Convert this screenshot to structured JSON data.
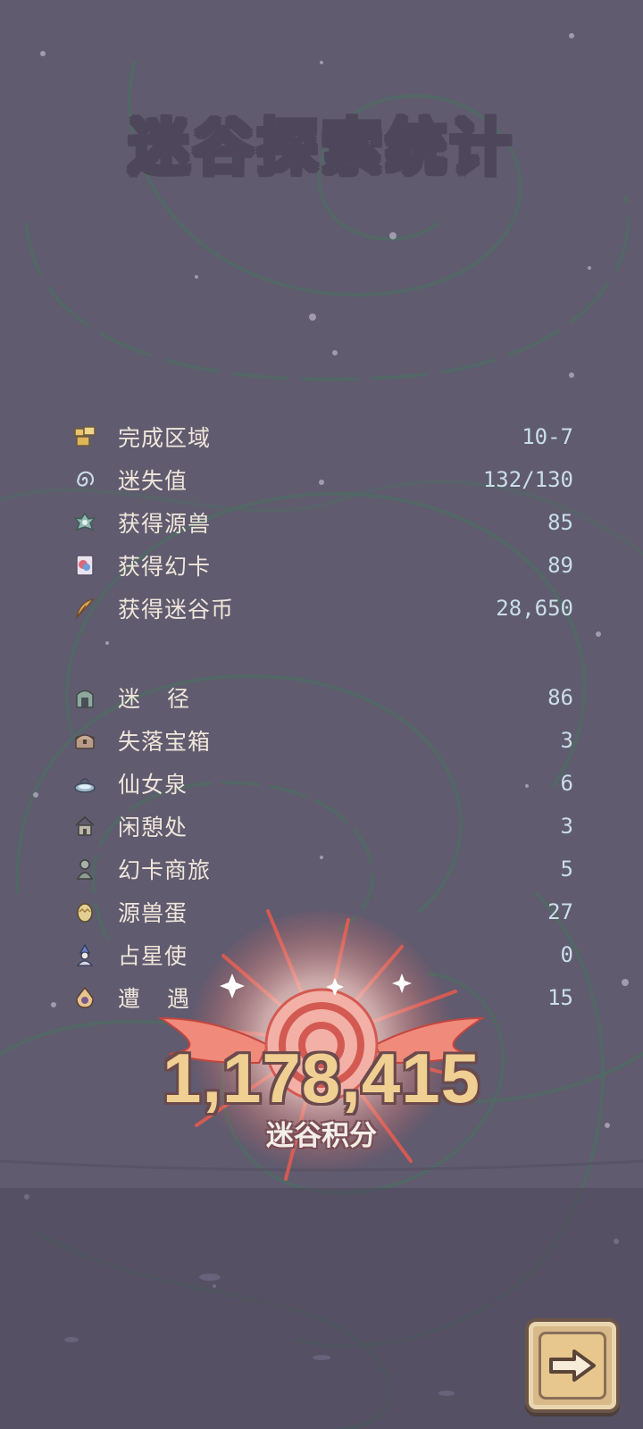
{
  "title": "迷谷探索统计",
  "summary_stats": [
    {
      "icon": "map-pieces-icon",
      "label": "完成区域",
      "value": "10-7"
    },
    {
      "icon": "swirl-icon",
      "label": "迷失值",
      "value": "132/130"
    },
    {
      "icon": "creature-icon",
      "label": "获得源兽",
      "value": "85"
    },
    {
      "icon": "card-icon",
      "label": "获得幻卡",
      "value": "89"
    },
    {
      "icon": "feather-coin-icon",
      "label": "获得迷谷币",
      "value": "28,650"
    }
  ],
  "encounter_stats": [
    {
      "icon": "path-gate-icon",
      "label": "迷径",
      "value": "86"
    },
    {
      "icon": "treasure-chest-icon",
      "label": "失落宝箱",
      "value": "3"
    },
    {
      "icon": "fairy-spring-icon",
      "label": "仙女泉",
      "value": "6"
    },
    {
      "icon": "rest-hut-icon",
      "label": "闲憩处",
      "value": "3"
    },
    {
      "icon": "merchant-icon",
      "label": "幻卡商旅",
      "value": "5"
    },
    {
      "icon": "egg-icon",
      "label": "源兽蛋",
      "value": "27"
    },
    {
      "icon": "astrologer-icon",
      "label": "占星使",
      "value": "0"
    },
    {
      "icon": "encounter-icon",
      "label": "遭遇",
      "value": "15"
    }
  ],
  "score": {
    "value": "1,178,415",
    "label": "迷谷积分"
  },
  "next_button": {
    "icon": "arrow-right-icon"
  },
  "colors": {
    "background": "#605b6f",
    "label_text": "#efe6da",
    "value_text": "#c9dfe6",
    "score_text": "#f0cf92",
    "burst": "#e85a4f"
  }
}
